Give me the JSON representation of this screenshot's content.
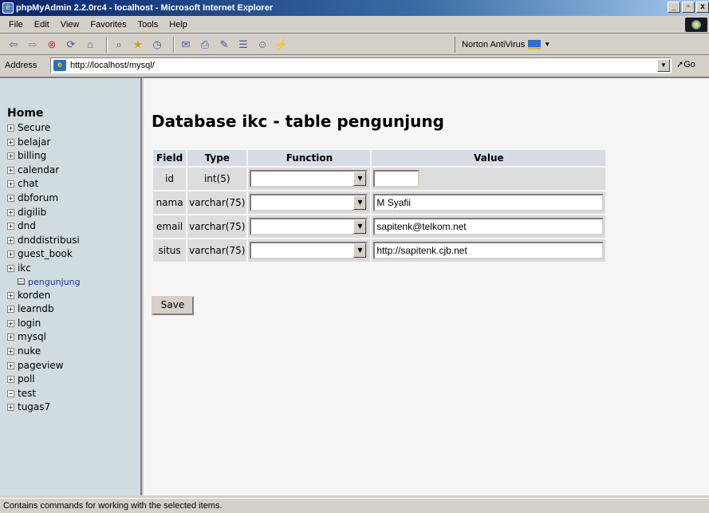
{
  "window": {
    "title": "phpMyAdmin 2.2.0rc4 - localhost - Microsoft Internet Explorer",
    "min_label": "_",
    "max_label": "3",
    "close_label": "x"
  },
  "menu": [
    "File",
    "Edit",
    "View",
    "Favorites",
    "Tools",
    "Help"
  ],
  "toolbar": {
    "norton_label": "Norton AntiVirus"
  },
  "address": {
    "label": "Address",
    "url": "http://localhost/mysql/",
    "go_label": "Go"
  },
  "sidebar": {
    "home": "Home",
    "databases": [
      {
        "name": "Secure",
        "expanded": false
      },
      {
        "name": "belajar",
        "expanded": false
      },
      {
        "name": "billing",
        "expanded": false
      },
      {
        "name": "calendar",
        "expanded": false
      },
      {
        "name": "chat",
        "expanded": false
      },
      {
        "name": "dbforum",
        "expanded": false
      },
      {
        "name": "digilib",
        "expanded": false
      },
      {
        "name": "dnd",
        "expanded": false
      },
      {
        "name": "dnddistribusi",
        "expanded": false
      },
      {
        "name": "guest_book",
        "expanded": false
      },
      {
        "name": "ikc",
        "expanded": false,
        "tables": [
          "pengunjung"
        ]
      },
      {
        "name": "korden",
        "expanded": false
      },
      {
        "name": "learndb",
        "expanded": false
      },
      {
        "name": "login",
        "expanded": false
      },
      {
        "name": "mysql",
        "expanded": false
      },
      {
        "name": "nuke",
        "expanded": false
      },
      {
        "name": "pageview",
        "expanded": false
      },
      {
        "name": "poll",
        "expanded": false
      },
      {
        "name": "test",
        "expanded": true
      },
      {
        "name": "tugas7",
        "expanded": false
      }
    ]
  },
  "main": {
    "title": "Database ikc - table pengunjung",
    "headers": {
      "field": "Field",
      "type": "Type",
      "function": "Function",
      "value": "Value"
    },
    "rows": [
      {
        "field": "id",
        "type": "int(5)",
        "function": "",
        "value": ""
      },
      {
        "field": "nama",
        "type": "varchar(75)",
        "function": "",
        "value": "M Syafii"
      },
      {
        "field": "email",
        "type": "varchar(75)",
        "function": "",
        "value": "sapitenk@telkom.net"
      },
      {
        "field": "situs",
        "type": "varchar(75)",
        "function": "",
        "value": "http://sapitenk.cjb.net"
      }
    ],
    "save_label": "Save"
  },
  "status": "Contains commands for working with the selected items."
}
